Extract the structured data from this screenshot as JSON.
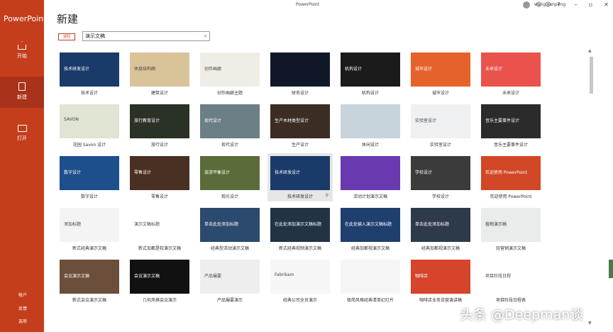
{
  "app": {
    "name": "PowerPoint",
    "window_title": "PowerPoint",
    "user": "wang jianpeng"
  },
  "nav": [
    {
      "label": "开始",
      "icon": "home-icon"
    },
    {
      "label": "新建",
      "icon": "new-document-icon",
      "active": true
    },
    {
      "label": "打开",
      "icon": "folder-icon"
    }
  ],
  "bottom_nav": [
    "帐户",
    "反馈",
    "选项"
  ],
  "titlebar_icons": [
    "smiley-icon",
    "frown-icon",
    "help-icon",
    "minimize-icon",
    "restore-icon",
    "close-icon"
  ],
  "header": {
    "title": "新建",
    "back_label": "返回",
    "search_value": "演示文稿"
  },
  "templates": [
    {
      "caption": "技术设计",
      "text": "技术研发设计",
      "bg": "#1a3a6a",
      "selected": false
    },
    {
      "caption": "建筑设计",
      "text": "休息结构图",
      "bg": "#d9c49a",
      "selected": false
    },
    {
      "caption": "创作画廊主题",
      "text": "创作画廊",
      "bg": "#f0ede6",
      "selected": false
    },
    {
      "caption": "财务设计",
      "text": "",
      "bg": "#101828",
      "selected": false
    },
    {
      "caption": "机构设计",
      "text": "机构设计",
      "bg": "#1b1b1b",
      "selected": false
    },
    {
      "caption": "城市设计",
      "text": "城市设计",
      "bg": "#e5622b",
      "selected": false
    },
    {
      "caption": "未来设计",
      "text": "未来设计",
      "bg": "#e9534b",
      "selected": false
    },
    {
      "caption": "花园 Savon 设计",
      "text": "SAVON",
      "bg": "#dfe4d3",
      "selected": false
    },
    {
      "caption": "旅行设计",
      "text": "旅行教育设计",
      "bg": "#2a3125",
      "selected": false
    },
    {
      "caption": "现代设计",
      "text": "现代设计",
      "bg": "#6c7e86",
      "selected": false
    },
    {
      "caption": "生产设计",
      "text": "生产木材类型设计",
      "bg": "#3b2d24",
      "selected": false
    },
    {
      "caption": "休闲设计",
      "text": "",
      "bg": "#c8d4dc",
      "selected": false
    },
    {
      "caption": "实验室设计",
      "text": "实验室设计",
      "bg": "#eef0f2",
      "selected": false
    },
    {
      "caption": "音乐主要事件设计",
      "text": "音乐主要事件设计",
      "bg": "#2b2b2b",
      "selected": false
    },
    {
      "caption": "数字设计",
      "text": "数字设计",
      "bg": "#1d4f8c",
      "selected": false
    },
    {
      "caption": "零售设计",
      "text": "零售设计",
      "bg": "#4a3022",
      "selected": false
    },
    {
      "caption": "观光设计",
      "text": "旅游平衡设计",
      "bg": "#5b6b3a",
      "selected": false
    },
    {
      "caption": "技术研发设计",
      "text": "技术研发设计",
      "bg": "#1a3a6a",
      "selected": true
    },
    {
      "caption": "活动计划演示文稿",
      "text": "",
      "bg": "#6a3ab0",
      "selected": false
    },
    {
      "caption": "学校设计",
      "text": "学校设计",
      "bg": "#3b3b3b",
      "selected": false
    },
    {
      "caption": "欢迎使用 PowerPoint",
      "text": "欢迎使用 PowerPoint",
      "bg": "#d24726",
      "selected": false
    },
    {
      "caption": "新式经典演示文稿",
      "text": "添加标题",
      "bg": "#f4f4f4",
      "selected": false
    },
    {
      "caption": "新式加都是较演示文稿",
      "text": "演示文稿标题",
      "bg": "#ffffff",
      "selected": false
    },
    {
      "caption": "经典型活动演示文稿",
      "text": "单击此处添加标题",
      "bg": "#2c4a6e",
      "selected": false
    },
    {
      "caption": "新式经典视频演示文稿",
      "text": "在此处添加演示文稿标题",
      "bg": "#223344",
      "selected": false
    },
    {
      "caption": "经典加都视演示文稿",
      "text": "在此处输入演示文稿标题",
      "bg": "#1f3f6f",
      "selected": false
    },
    {
      "caption": "经典加都视演示文稿",
      "text": "单击此处添加标题",
      "bg": "#2d3a4a",
      "selected": false
    },
    {
      "caption": "轻营销演示文稿",
      "text": "植物演示稿",
      "bg": "#e8ecea",
      "selected": false
    },
    {
      "caption": "新式会议演示文稿",
      "text": "会议演示文稿",
      "bg": "#6b4f3a",
      "selected": false
    },
    {
      "caption": "几何风格会议演示",
      "text": "会议演示文稿",
      "bg": "#111111",
      "selected": false
    },
    {
      "caption": "产品撮要演示",
      "text": "产品撮要",
      "bg": "#eeeeee",
      "selected": false
    },
    {
      "caption": "经典公司全员演示",
      "text": "Fabrikam",
      "bg": "#f6f6f6",
      "selected": false
    },
    {
      "caption": "极简风格经典清单幻灯片",
      "text": "",
      "bg": "#f5f5f5",
      "selected": false
    },
    {
      "caption": "咖啡店业务说营演讲稿",
      "text": "咖啡店",
      "bg": "#d5442b",
      "selected": false
    },
    {
      "caption": "项目阶段日程表",
      "text": "项目阶段日程",
      "bg": "#ffffff",
      "selected": false
    }
  ],
  "watermark": "头条 @Deepman谈"
}
